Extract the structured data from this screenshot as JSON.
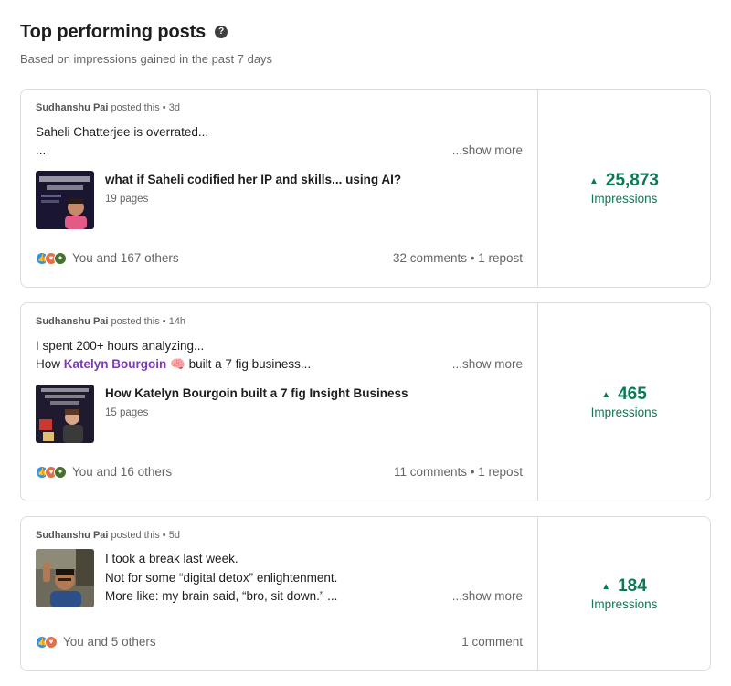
{
  "header": {
    "title": "Top performing posts",
    "subtitle": "Based on impressions gained in the past 7 days",
    "help_icon": "question-circle-icon"
  },
  "colors": {
    "impressions_green": "#0a7a52",
    "mention_purple": "#7a3bb5",
    "border": "#dcdcdc"
  },
  "posts": [
    {
      "author": "Sudhanshu Pai",
      "posted_suffix": "posted this • 3d",
      "line1": "Saheli Chatterjee is overrated...",
      "line2": "...",
      "show_more": "...show more",
      "doc_title": "what if Saheli codified her IP and skills... using AI?",
      "doc_pages": "19 pages",
      "reactions_text": "You and 167 others",
      "stats": "32 comments • 1 repost",
      "impressions": "25,873",
      "impressions_label": "Impressions"
    },
    {
      "author": "Sudhanshu Pai",
      "posted_suffix": "posted this • 14h",
      "line1": "I spent 200+ hours analyzing...",
      "line2_prefix": "How ",
      "line2_mention": "Katelyn Bourgoin",
      "line2_emoji": "🧠",
      "line2_suffix": " built a 7 fig business...",
      "show_more": "...show more",
      "doc_title": "How Katelyn Bourgoin built a 7 fig Insight Business",
      "doc_pages": "15 pages",
      "reactions_text": "You and 16 others",
      "stats": "11 comments • 1 repost",
      "impressions": "465",
      "impressions_label": "Impressions"
    },
    {
      "author": "Sudhanshu Pai",
      "posted_suffix": "posted this • 5d",
      "line1": "I took a break last week.",
      "line2": "Not for some “digital detox” enlightenment.",
      "line3": "More like: my brain said, “bro, sit down.” ...",
      "show_more": "...show more",
      "reactions_text": "You and 5 others",
      "stats": "1 comment",
      "impressions": "184",
      "impressions_label": "Impressions"
    }
  ]
}
